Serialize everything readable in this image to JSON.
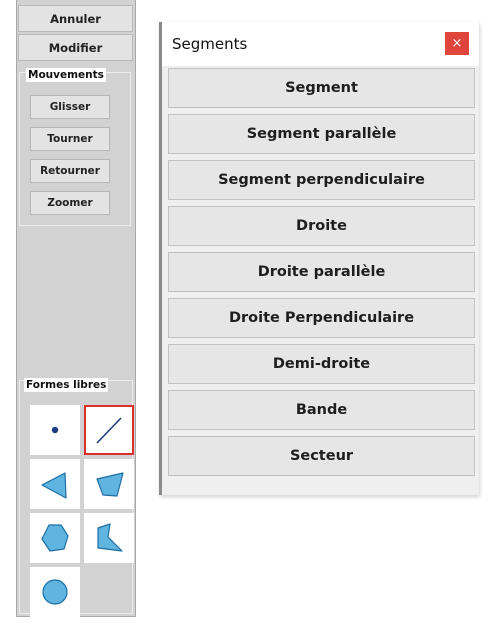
{
  "toolbar": {
    "undo_label": "Annuler",
    "edit_label": "Modifier"
  },
  "movements": {
    "legend": "Mouvements",
    "items": [
      "Glisser",
      "Tourner",
      "Retourner",
      "Zoomer"
    ]
  },
  "free_shapes": {
    "legend": "Formes libres",
    "tools": [
      "point-icon",
      "segment-line-icon",
      "triangle-icon",
      "quadrilateral-icon",
      "hexagon-icon",
      "concave-polygon-icon",
      "circle-icon"
    ],
    "selected_tool": "segment-line-icon"
  },
  "segments_window": {
    "title": "Segments",
    "close_symbol": "×",
    "items": [
      "Segment",
      "Segment parallèle",
      "Segment perpendiculaire",
      "Droite",
      "Droite parallèle",
      "Droite Perpendiculaire",
      "Demi-droite",
      "Bande",
      "Secteur"
    ]
  },
  "colors": {
    "shape_fill": "#5fb4e0",
    "shape_stroke": "#1e6fa5",
    "point": "#1c3f82",
    "selected_border": "#d9312a",
    "close_button": "#e0453b"
  }
}
